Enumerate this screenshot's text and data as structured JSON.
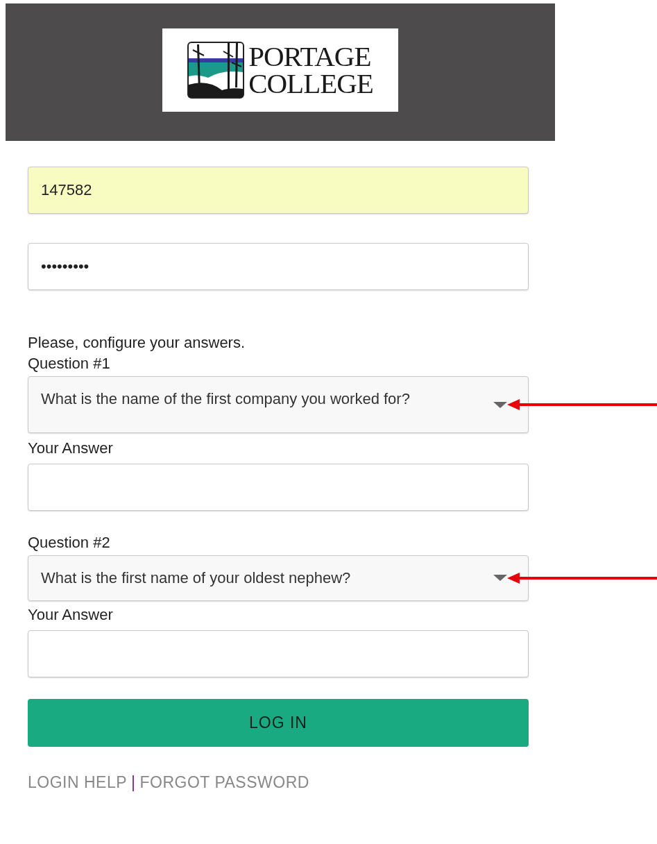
{
  "header": {
    "logo": {
      "line_1": "PORTAGE",
      "line_2": "COLLEGE"
    }
  },
  "login": {
    "user_id": {
      "value": "147582",
      "autofilled": true
    },
    "password": {
      "value": "•••••••••",
      "autofilled": false
    }
  },
  "instructions": "Please, configure your answers.",
  "questions": [
    {
      "label": "Question #1",
      "question": "What is the name of the first company you worked for?",
      "annotated": true,
      "answer_label": "Your Answer"
    },
    {
      "label": "Question #2",
      "question": "What is the first name of your oldest nephew?",
      "annotated": true,
      "answer_label": "Your Answer"
    }
  ],
  "submit_button": "LOG IN",
  "links": [
    {
      "label": "LOGIN HELP"
    },
    {
      "label": "FORGOT PASSWORD"
    }
  ],
  "link_separator": "|"
}
